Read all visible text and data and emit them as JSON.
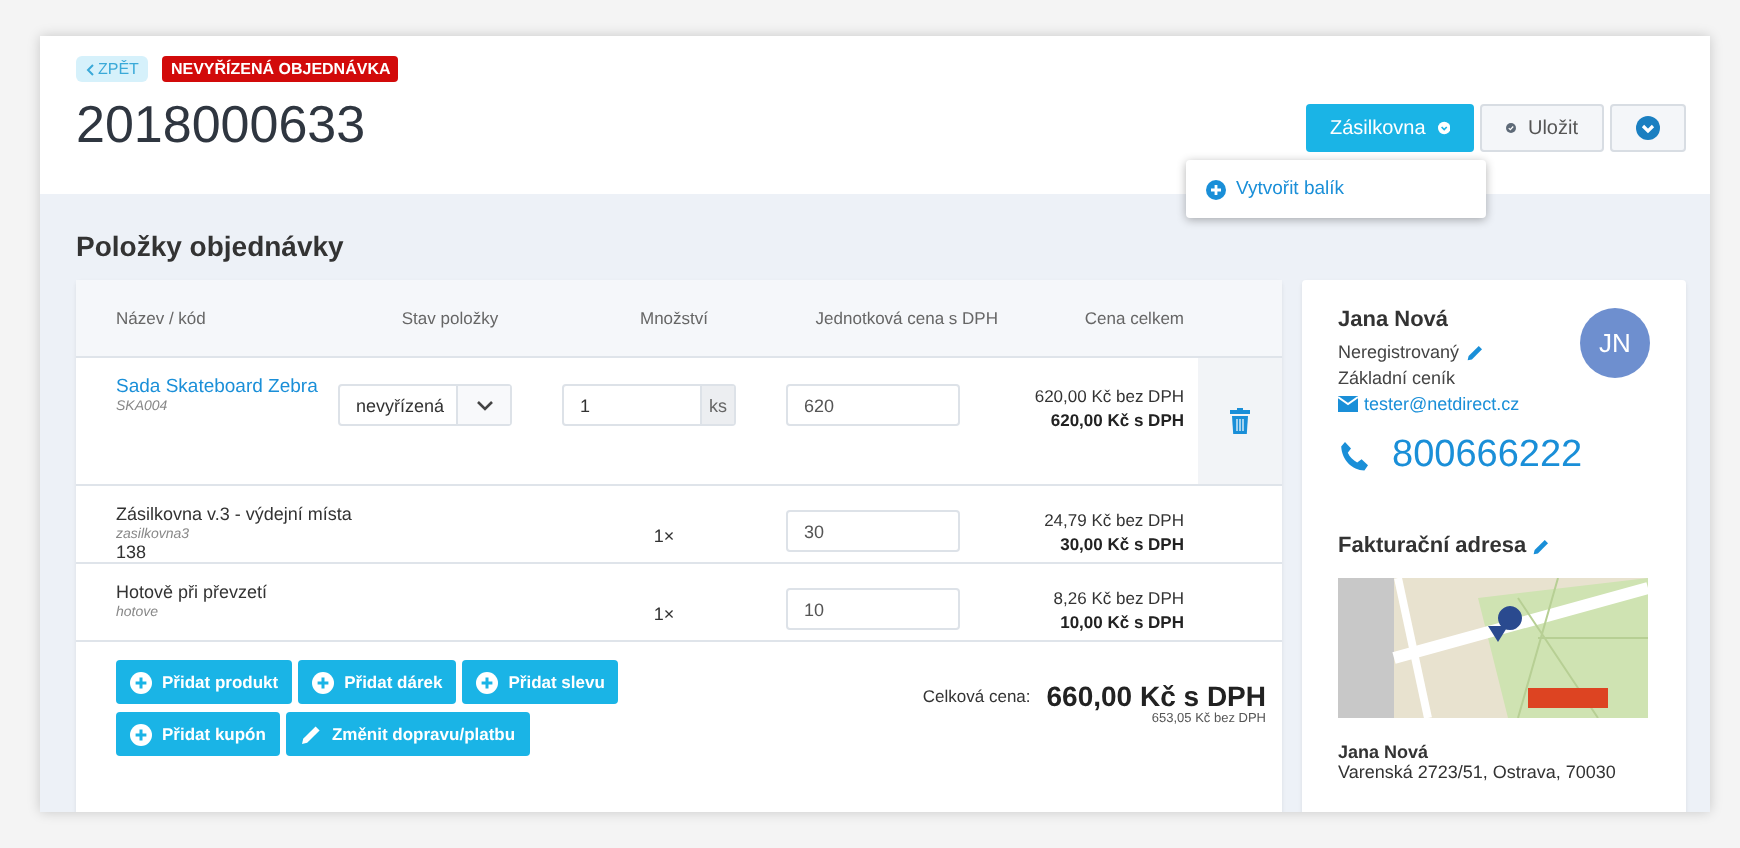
{
  "header": {
    "back_link": "ZPĚT",
    "status_badge": "NEVYŘÍZENÁ OBJEDNÁVKA",
    "order_number": "2018000633",
    "actions": [
      {
        "label": "Zásilkovna",
        "kind": "primary"
      },
      {
        "label": "Uložit",
        "kind": "save"
      },
      {
        "kind": "more"
      }
    ],
    "dropdown": {
      "open": true,
      "items": [
        "Vytvořit balík"
      ]
    }
  },
  "items_section": {
    "title": "Položky objednávky",
    "columns": [
      "Název / kód",
      "Stav položky",
      "Množství",
      "Jednotková cena s DPH",
      "Cena celkem"
    ],
    "rows": [
      {
        "kind": "product",
        "name": "Sada Skateboard Zebra",
        "code": "SKA004",
        "status": "nevyřízená",
        "quantity": "1",
        "unit": "ks",
        "unit_price": "620",
        "price_without_vat": "620,00 Kč bez DPH",
        "price_with_vat": "620,00 Kč s DPH"
      },
      {
        "kind": "service",
        "name": "Zásilkovna v.3 - výdejní místa",
        "code": "zasilkovna3",
        "extra": "138",
        "quantity": "1×",
        "unit_price": "30",
        "price_without_vat": "24,79 Kč bez DPH",
        "price_with_vat": "30,00 Kč s DPH"
      },
      {
        "kind": "service",
        "name": "Hotově při převzetí",
        "code": "hotove",
        "quantity": "1×",
        "unit_price": "10",
        "price_without_vat": "8,26 Kč bez DPH",
        "price_with_vat": "10,00 Kč s DPH"
      }
    ],
    "buttons": [
      {
        "label": "Přidat produkt",
        "kind": "add"
      },
      {
        "label": "Přidat dárek",
        "kind": "add"
      },
      {
        "label": "Přidat slevu",
        "kind": "add"
      },
      {
        "label": "Přidat kupón",
        "kind": "add"
      },
      {
        "label": "Změnit dopravu/platbu",
        "kind": "edit"
      }
    ],
    "total_label": "Celková cena:",
    "total_with_vat": "660,00 Kč s DPH",
    "total_without_vat": "653,05 Kč bez DPH"
  },
  "customer": {
    "name": "Jana Nová",
    "initials": "JN",
    "registration": "Neregistrovaný",
    "price_list": "Základní ceník",
    "email": "tester@netdirect.cz",
    "phone": "800666222",
    "billing_title": "Fakturační adresa",
    "billing_name": "Jana Nová",
    "billing_address": "Varenská 2723/51, Ostrava, 70030"
  }
}
